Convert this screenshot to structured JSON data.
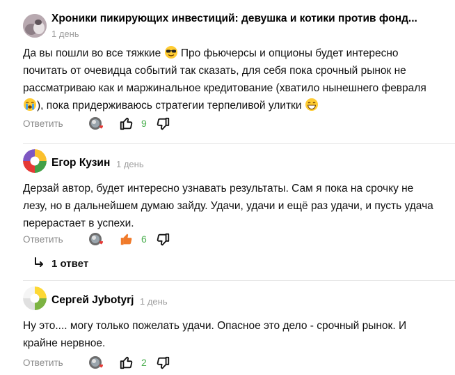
{
  "comments": [
    {
      "author": "Хроники пикирующих инвестиций: девушка и котики против фонд...",
      "time": "1 день",
      "text_part1": "Да вы пошли во все тяжкие ",
      "emoji1": "sunglasses-emoji",
      "text_part2": " Про фьючерсы и опционы будет интересно почитать от очевидца событий так сказать, для себя пока срочный рынок не рассматриваю как и маржинальное кредитование (хватило нынешнего февраля ",
      "emoji2": "crying-emoji",
      "text_part3": "), пока придерживаюсь стратегии терпеливой улитки ",
      "emoji3": "grin-emoji",
      "reply_label": "Ответить",
      "likes": "9"
    },
    {
      "author": "Егор Кузин",
      "time": "1 день",
      "text": "Дерзай автор, будет интересно узнавать результаты. Сам я пока на срочку не лезу, но в дальнейшем думаю зайду. Удачи, удачи и ещё раз удачи, и пусть удача перерастает в успехи.",
      "reply_label": "Ответить",
      "likes": "6",
      "replies_label": "1 ответ"
    },
    {
      "author": "Сергей Jybotyrj",
      "time": "1 день",
      "text": "Ну это.... могу только пожелать удачи. Опасное это дело - срочный рынок. И крайне нервное.",
      "reply_label": "Ответить",
      "likes": "2"
    }
  ],
  "colors": {
    "like_count": "#4caf50",
    "liked_thumb": "#f07a2a",
    "muted_text": "#9e9e9e"
  }
}
